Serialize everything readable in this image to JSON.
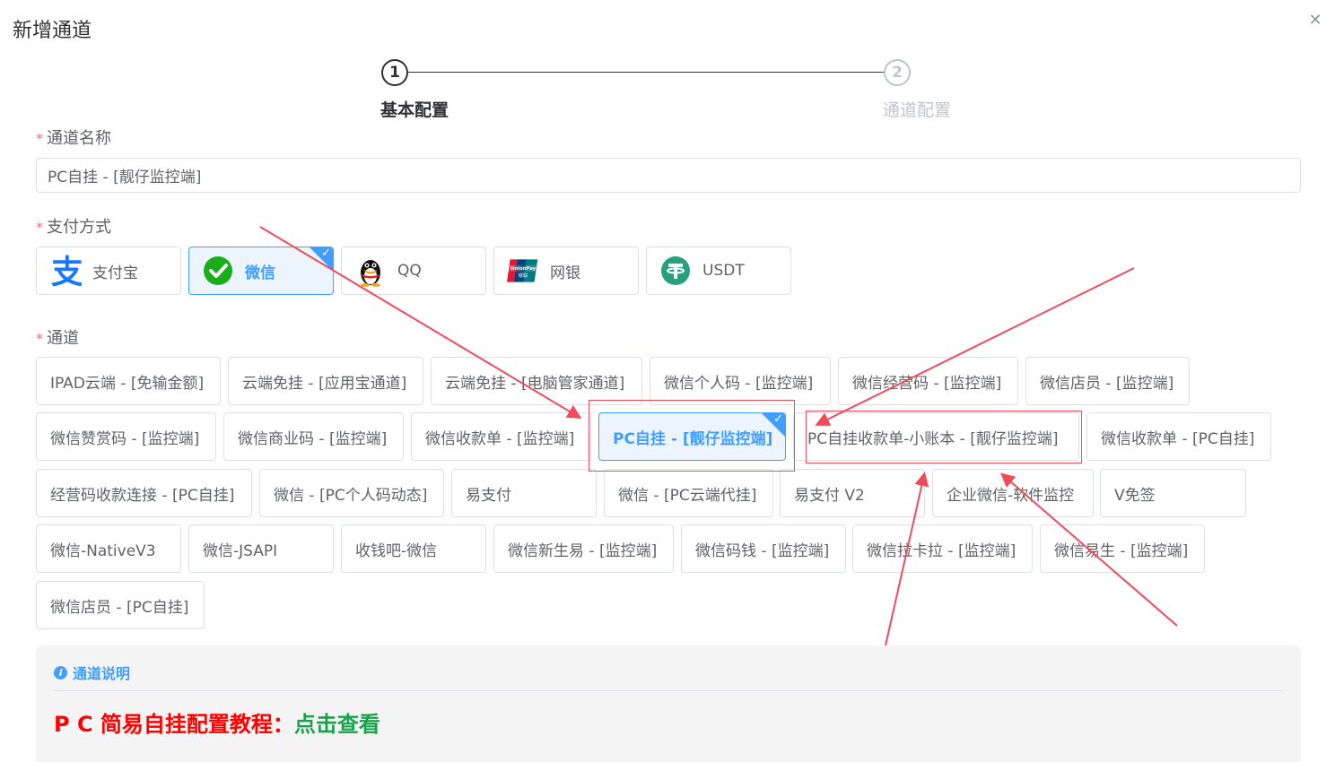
{
  "dialog": {
    "title": "新增通道",
    "close": "✕"
  },
  "steps": [
    {
      "num": "1",
      "label": "基本配置"
    },
    {
      "num": "2",
      "label": "通道配置"
    }
  ],
  "form": {
    "name_label": "通道名称",
    "name_value": "PC自挂 - [靓仔监控端]",
    "pay_label": "支付方式",
    "channel_label": "通道",
    "required_mark": "*"
  },
  "pay_methods": [
    {
      "label": "支付宝",
      "icon": "alipay-icon",
      "active": false
    },
    {
      "label": "微信",
      "icon": "wechat-icon",
      "active": true
    },
    {
      "label": "QQ",
      "icon": "qq-icon",
      "active": false
    },
    {
      "label": "网银",
      "icon": "unionpay-icon",
      "active": false
    },
    {
      "label": "USDT",
      "icon": "tether-icon",
      "active": false
    }
  ],
  "channels": [
    "IPAD云端 - [免输金额]",
    "云端免挂 - [应用宝通道]",
    "云端免挂 - [电脑管家通道]",
    "微信个人码 - [监控端]",
    "微信经营码 - [监控端]",
    "微信店员 - [监控端]",
    "微信赞赏码 - [监控端]",
    "微信商业码 - [监控端]",
    "微信收款单 - [监控端]",
    "PC自挂 - [靓仔监控端]",
    "PC自挂收款单-小账本 - [靓仔监控端]",
    "微信收款单 - [PC自挂]",
    "经营码收款连接 - [PC自挂]",
    "微信 - [PC个人码动态]",
    "易支付",
    "微信 - [PC云端代挂]",
    "易支付 V2",
    "企业微信-软件监控",
    "V免签",
    "微信-NativeV3",
    "微信-JSAPI",
    "收钱吧-微信",
    "微信新生易 - [监控端]",
    "微信码钱 - [监控端]",
    "微信拉卡拉 - [监控端]",
    "微信易生 - [监控端]",
    "微信店员 - [PC自挂]"
  ],
  "selected_channel": "PC自挂 - [靓仔监控端]",
  "info": {
    "title": "通道说明",
    "tutorial_prefix": "P C 简易自挂配置教程：",
    "tutorial_link": "点击查看"
  },
  "colors": {
    "primary": "#409eff",
    "annotation": "#f04b5b",
    "required": "#f56c6c",
    "link_green": "#16a34a",
    "tutorial_red": "#ff0000"
  }
}
